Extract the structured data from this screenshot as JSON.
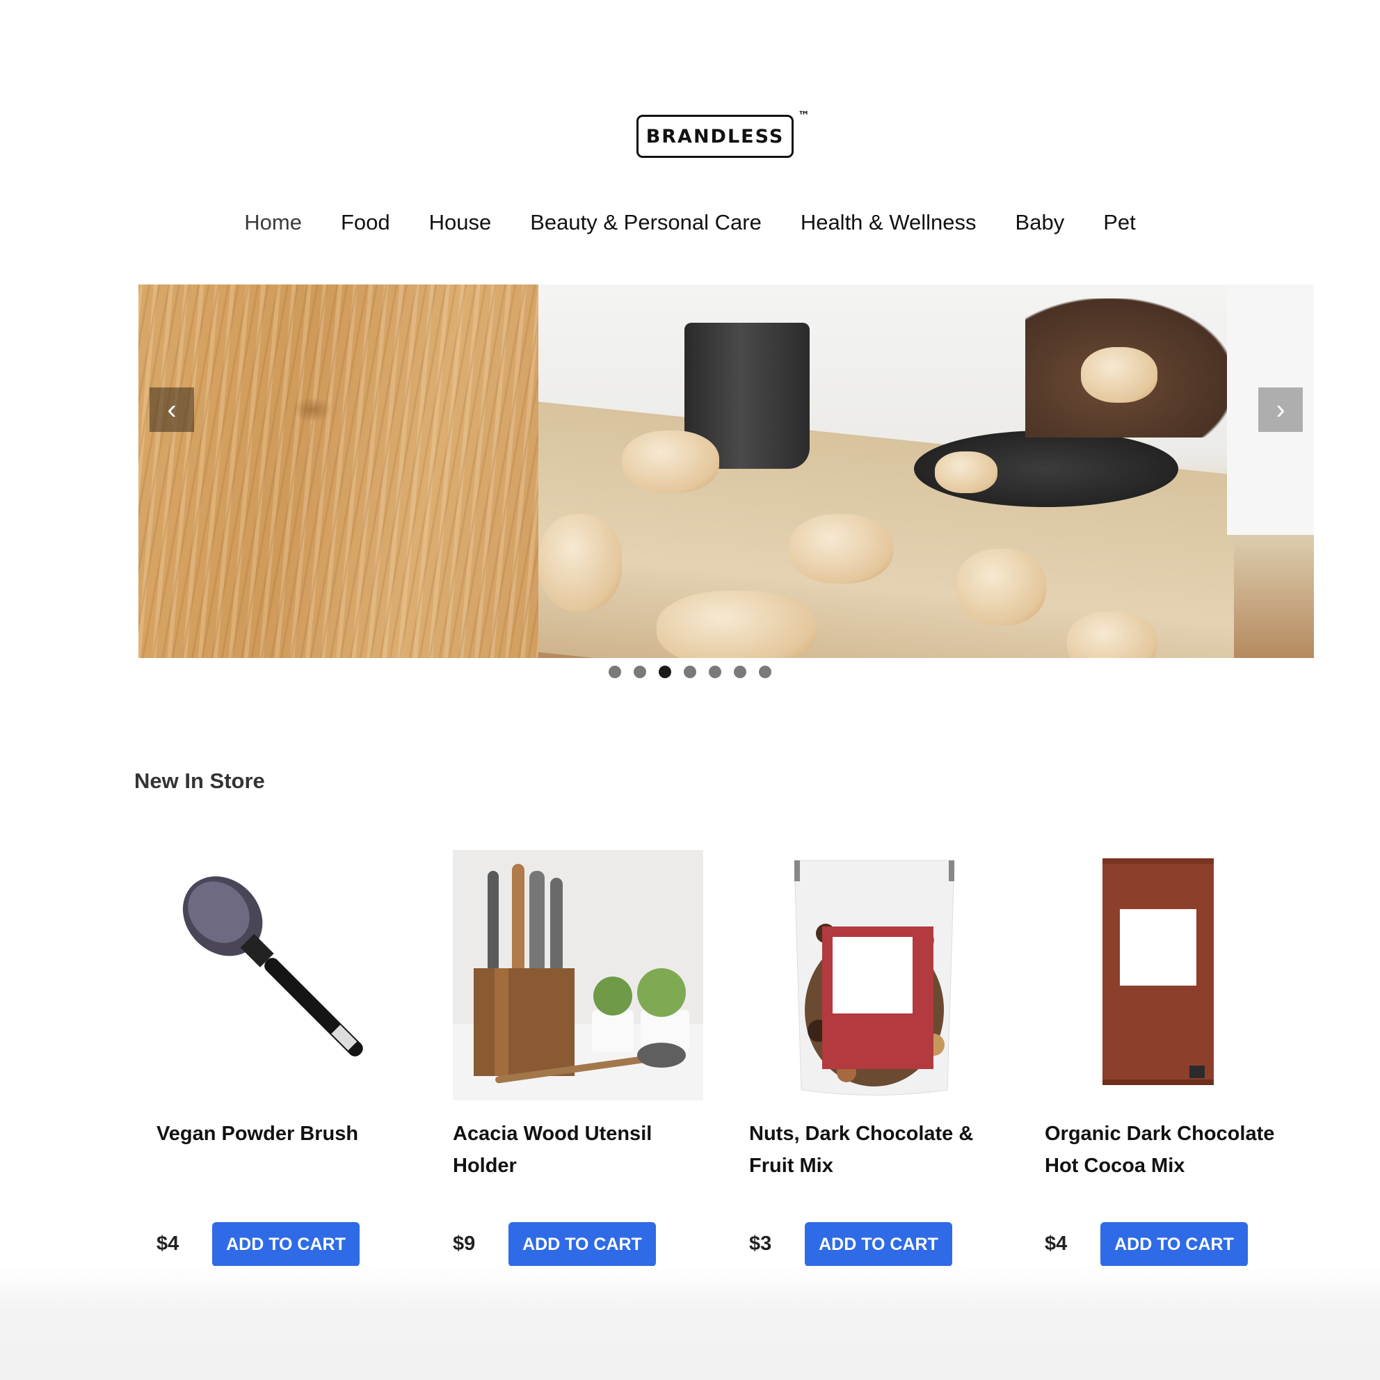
{
  "brand": {
    "name": "BRANDLESS",
    "tm": "™"
  },
  "nav": {
    "items": [
      {
        "label": "Home",
        "active": true
      },
      {
        "label": "Food"
      },
      {
        "label": "House"
      },
      {
        "label": "Beauty & Personal Care"
      },
      {
        "label": "Health & Wellness"
      },
      {
        "label": "Baby"
      },
      {
        "label": "Pet"
      }
    ]
  },
  "carousel": {
    "prev_icon": "chevron-left-icon",
    "next_icon": "chevron-right-icon",
    "prev_glyph": "‹",
    "next_glyph": "›",
    "slide_count": 7,
    "active_index": 2
  },
  "section": {
    "title": "New In Store"
  },
  "products": [
    {
      "name": "Vegan Powder Brush",
      "price": "$4",
      "button": "ADD TO CART"
    },
    {
      "name": "Acacia Wood Utensil Holder",
      "price": "$9",
      "button": "ADD TO CART"
    },
    {
      "name": "Nuts, Dark Chocolate & Fruit Mix",
      "price": "$3",
      "button": "ADD TO CART"
    },
    {
      "name": "Organic Dark Chocolate Hot Cocoa Mix",
      "price": "$4",
      "button": "ADD TO CART"
    }
  ],
  "colors": {
    "accent": "#2f6be6",
    "text": "#111111"
  }
}
